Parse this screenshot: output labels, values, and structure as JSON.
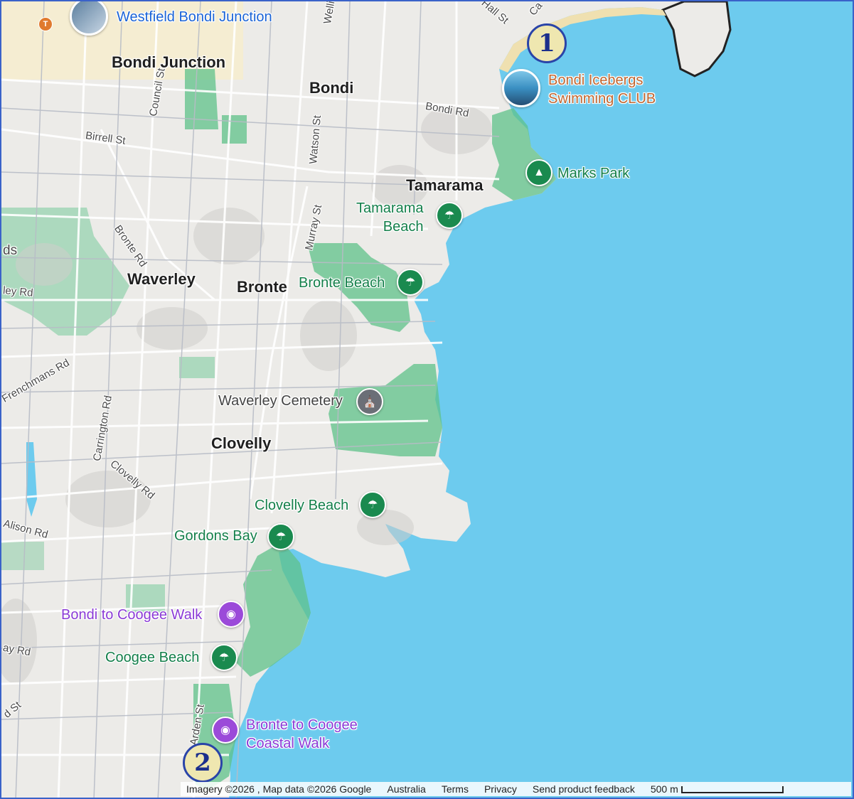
{
  "map": {
    "suburbs": [
      "Bondi Junction",
      "Bondi",
      "Tamarama",
      "Waverley",
      "Bronte",
      "Clovelly"
    ],
    "streets": [
      "Wellington",
      "Hall St",
      "Council St",
      "Birrell St",
      "Watson St",
      "Bondi Rd",
      "Bronte Rd",
      "Murray St",
      "Frenchmans Rd",
      "Carrington Rd",
      "Clovelly Rd",
      "Alison Rd",
      "Arden St",
      "Ca",
      "ley Rd",
      "ay Rd",
      "d St",
      "ds"
    ],
    "places": {
      "westfield": "Westfield Bondi Junction",
      "icebergs": "Bondi Icebergs\nSwimming CLUB",
      "icebergs_line1": "Bondi Icebergs",
      "icebergs_line2": "Swimming CLUB",
      "marks_park": "Marks Park",
      "tamarama_beach_1": "Tamarama",
      "tamarama_beach_2": "Beach",
      "bronte_beach": "Bronte Beach",
      "waverley_cemetery": "Waverley Cemetery",
      "clovelly_beach": "Clovelly Beach",
      "gordons_bay": "Gordons Bay",
      "bondi_coogee_walk": "Bondi to Coogee Walk",
      "coogee_beach": "Coogee Beach",
      "bronte_coogee_1": "Bronte to Coogee",
      "bronte_coogee_2": "Coastal Walk"
    },
    "markers": [
      "1",
      "2"
    ],
    "transit_badge": "T"
  },
  "footer": {
    "imagery": "Imagery ©2026 , Map data ©2026 Google",
    "country": "Australia",
    "terms": "Terms",
    "privacy": "Privacy",
    "feedback": "Send product feedback",
    "scale": "500 m"
  },
  "colors": {
    "water": "#6dcbee",
    "land": "#ecebe8",
    "park": "#5fc28a",
    "beach": "#efe0b0",
    "marker_fill": "#efe7b0",
    "marker_border": "#2a44a8"
  },
  "icons": [
    "tree-icon",
    "beach-umbrella-icon",
    "camera-icon",
    "cemetery-icon",
    "train-icon"
  ]
}
